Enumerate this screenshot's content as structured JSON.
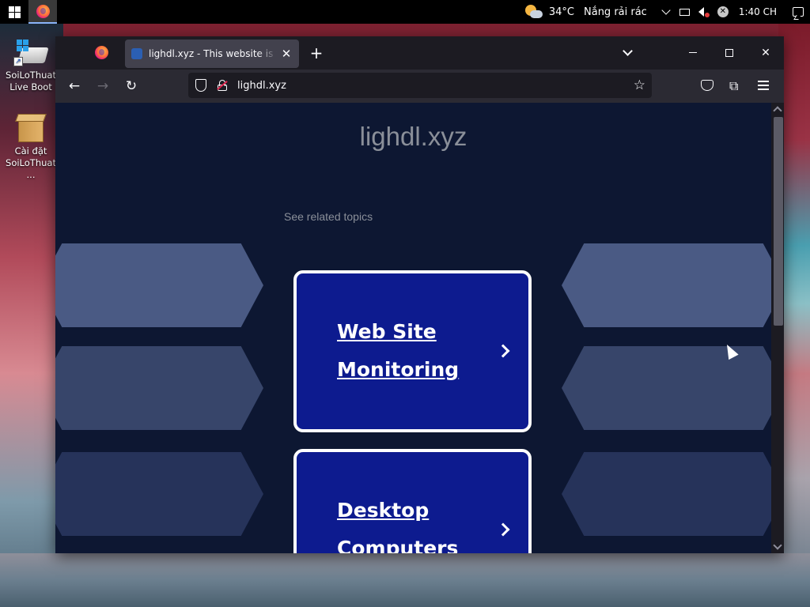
{
  "taskbar": {
    "weather": {
      "temp": "34°C",
      "desc": "Nắng rải rác"
    },
    "clock": "1:40 CH"
  },
  "desktop": {
    "icons": [
      {
        "label_line1": "SoiLoThuat",
        "label_line2": "Live Boot"
      },
      {
        "label_line1": "Cài đặt",
        "label_line2": "SoiLoThuat ..."
      }
    ]
  },
  "browser": {
    "tab": {
      "title": "lighdl.xyz - This website is for sale!"
    },
    "url": "lighdl.xyz"
  },
  "page": {
    "site_title": "lighdl.xyz",
    "related_label": "See related topics",
    "cards": [
      {
        "line1": "Web Site",
        "line2": "Monitoring"
      },
      {
        "line1": "Desktop",
        "line2": "Computers"
      }
    ]
  },
  "colors": {
    "page_bg": "#0d1732",
    "card_bg": "#0d1b8f",
    "hex": "#4a5a84",
    "browser_chrome": "#2b2a33"
  },
  "icons": [
    "windows-logo-icon",
    "firefox-icon",
    "weather-icon",
    "chevron-up-icon",
    "network-icon",
    "volume-muted-icon",
    "close-circle-icon",
    "notification-icon",
    "shield-icon",
    "lock-icon",
    "star-icon",
    "pocket-icon",
    "extensions-icon",
    "menu-icon"
  ]
}
